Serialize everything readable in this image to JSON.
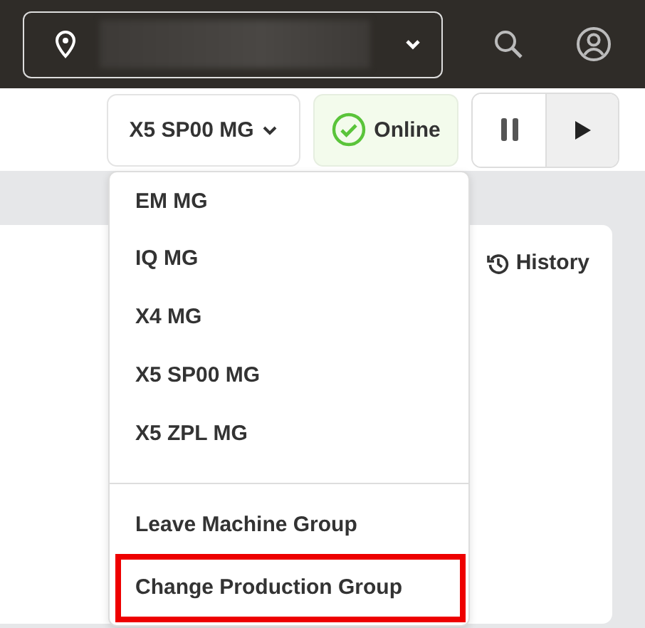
{
  "toolbar": {
    "machine_group": "X5 SP00 MG",
    "status": {
      "label": "Online",
      "online": true
    },
    "playback": {
      "paused": false
    }
  },
  "panel": {
    "history_link": "History"
  },
  "menu": {
    "items": [
      {
        "kind": "group",
        "label": "EM MG",
        "highlighted": false
      },
      {
        "kind": "group",
        "label": "IQ MG",
        "highlighted": false
      },
      {
        "kind": "group",
        "label": "X4 MG",
        "highlighted": false
      },
      {
        "kind": "group",
        "label": "X5 SP00 MG",
        "highlighted": false
      },
      {
        "kind": "group",
        "label": "X5 ZPL MG",
        "highlighted": false
      },
      {
        "kind": "divider"
      },
      {
        "kind": "action",
        "label": "Leave Machine Group",
        "highlighted": false
      },
      {
        "kind": "action",
        "label": "Change Production Group",
        "highlighted": true
      }
    ]
  }
}
